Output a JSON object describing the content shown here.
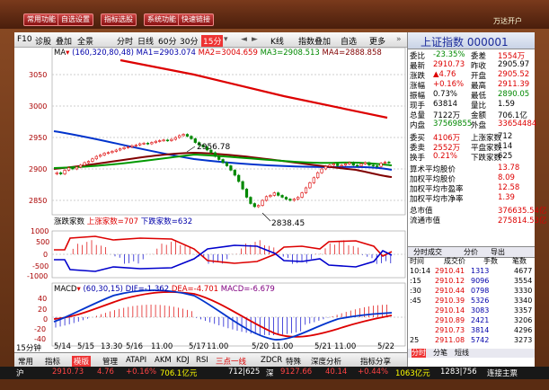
{
  "top": {
    "buttons": [
      "常用功能",
      "自选设置",
      "指标选股",
      "系统功能",
      "快速链接"
    ],
    "right": "万达开户"
  },
  "toolbar": {
    "f10": "F10",
    "diag": "诊股",
    "compare": "叠加",
    "all": "全景",
    "time_label": "分时",
    "day_label": "日线",
    "min60_label": "60分",
    "min30_label": "30分",
    "min15_label": "15分",
    "kline": "K线",
    "ind_add": "指数叠加",
    "zixuan": "自选",
    "more": "更多"
  },
  "ma_line": {
    "head": "MA",
    "params": "(160,320,80,48)",
    "ma1": "MA1=2903.074",
    "ma2": "MA2=3004.659",
    "ma3": "MA3=2908.513",
    "ma4": "MA4=2888.858"
  },
  "colors": {
    "ma1": "#0033cc",
    "ma2": "#dd0000",
    "ma3": "#009900",
    "ma4": "#800000",
    "up": "#dd0000",
    "down": "#008800"
  },
  "price_axis": [
    "3050",
    "3000",
    "2950",
    "2900",
    "2850"
  ],
  "annotations": {
    "high": "2956.78",
    "low": "2838.45"
  },
  "updown": {
    "title": "涨跌家数",
    "up": "上涨家数=707",
    "down": "下跌家数=632",
    "axis": [
      "1000",
      "500",
      "0",
      "-500",
      "-1000"
    ]
  },
  "macd": {
    "title": "MACD",
    "params": "(60,30,15)",
    "dif": "DIF=-1.362",
    "dea": "DEA=-4.701",
    "macd": "MACD=-6.679",
    "axis": [
      "40",
      "20",
      "0",
      "-20",
      "-40"
    ]
  },
  "time_axis": {
    "period": "15分钟",
    "labels": [
      "5/14",
      "5/15",
      "13.30",
      "5/16",
      "11.00",
      "5/17",
      "11.00",
      "5/20",
      "11.00",
      "5/21",
      "11.00",
      "5/22"
    ]
  },
  "bottom_tabs": [
    "常用",
    "指标",
    "模版",
    "管理",
    "ATAPI",
    "AKM",
    "KDJ",
    "RSI",
    "三点一线",
    "ZDCR",
    "特殊",
    "深度分析",
    "指标分享"
  ],
  "quote": {
    "title": "上证指数 000001",
    "rows": [
      [
        "委比",
        "-23.35%",
        "委差",
        "1554万"
      ],
      [
        "最新",
        "2910.73",
        "昨收",
        "2905.97"
      ],
      [
        "涨跌",
        "▲4.76",
        "开盘",
        "2905.52"
      ],
      [
        "涨幅",
        "+0.16%",
        "最高",
        "2911.39"
      ],
      [
        "振幅",
        "0.73%",
        "最低",
        "2890.05"
      ],
      [
        "现手",
        "63814",
        "量比",
        "1.59"
      ],
      [
        "总量",
        "7122万",
        "金额",
        "706.1亿"
      ],
      [
        "内盘",
        "37569855",
        "外盘",
        "33654484"
      ]
    ],
    "rows2": [
      [
        "委买",
        "4106万",
        "上涨家数",
        "712"
      ],
      [
        "委卖",
        "2552万",
        "平盘家数",
        "114"
      ],
      [
        "换手",
        "0.21%",
        "下跌家数",
        "625"
      ]
    ],
    "avg": [
      [
        "算术平均股价",
        "13.78"
      ],
      [
        "加权平均股价",
        "8.09"
      ],
      [
        "加权平均市盈率",
        "12.58"
      ],
      [
        "加权平均市净率",
        "1.39"
      ]
    ],
    "mcap": [
      [
        "总市值",
        "376635.54亿"
      ],
      [
        "流通市值",
        "275814.53亿"
      ]
    ],
    "tab": [
      "分时成交",
      "分价",
      "导出"
    ],
    "ticks_head": [
      "时间",
      "成交价",
      "手数",
      "笔数"
    ],
    "ticks": [
      [
        "10:14",
        "2910.41",
        "1313",
        "4677"
      ],
      [
        ":15",
        "2910.12",
        "9096",
        "3554"
      ],
      [
        ":30",
        "2910.44",
        "0798",
        "3330"
      ],
      [
        ":45",
        "2910.39",
        "5326",
        "3340"
      ],
      [
        "",
        "2910.14",
        "3083",
        "3357"
      ],
      [
        "",
        "2910.89",
        "2421",
        "3206"
      ],
      [
        "",
        "2910.73",
        "3814",
        "4296"
      ],
      [
        "25",
        "2911.08",
        "5742",
        "3273"
      ]
    ],
    "tabs_bottom": [
      "分时",
      "分笔",
      "短线"
    ]
  },
  "status": {
    "sh_label": "沪",
    "sh_price": "2910.73",
    "sh_change": "4.76",
    "sh_pct": "+0.16%",
    "sh_amt": "706.1亿元",
    "sh_ud": "712|625",
    "sz_label": "深",
    "sz_price": "9127.66",
    "sz_change": "40.14",
    "sz_pct": "+0.44%",
    "sz_amt": "1063亿元",
    "sz_ud": "1283|756",
    "conn": "连接主票"
  }
}
